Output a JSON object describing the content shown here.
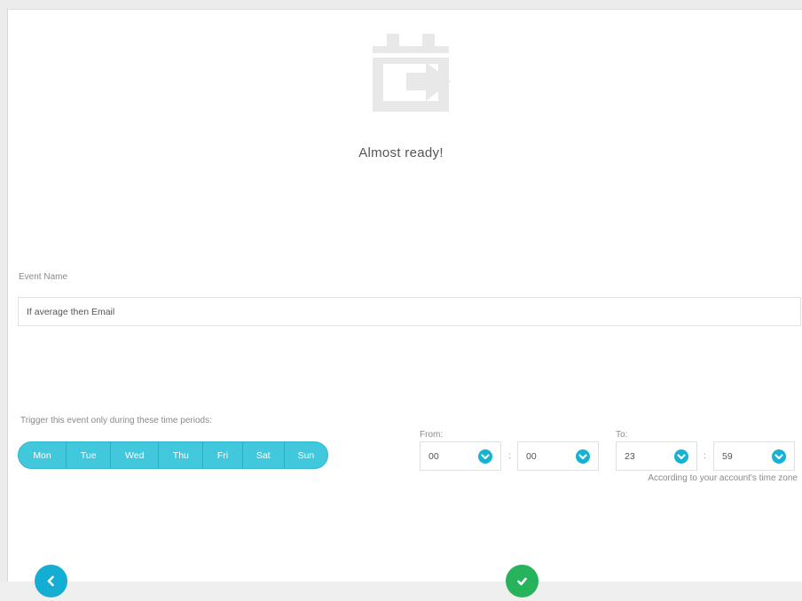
{
  "header": {
    "title": "Almost ready!",
    "icon": "calendar-arrow-icon"
  },
  "event_name": {
    "label": "Event Name",
    "value": "If average then Email"
  },
  "schedule": {
    "label": "Trigger this event only during these time periods:",
    "days": [
      {
        "label": "Mon",
        "selected": true
      },
      {
        "label": "Tue",
        "selected": true
      },
      {
        "label": "Wed",
        "selected": true
      },
      {
        "label": "Thu",
        "selected": true
      },
      {
        "label": "Fri",
        "selected": true
      },
      {
        "label": "Sat",
        "selected": true
      },
      {
        "label": "Sun",
        "selected": true
      }
    ],
    "from": {
      "label": "From:",
      "hour": "00",
      "minute": "00"
    },
    "to": {
      "label": "To:",
      "hour": "23",
      "minute": "59"
    },
    "separator": ":",
    "timezone_note": "According to your account's time zone"
  },
  "footer": {
    "back_icon": "chevron-left-icon",
    "confirm_icon": "checkmark-icon"
  },
  "colors": {
    "accent": "#41c8dc",
    "chevron": "#16b2d4",
    "back_button": "#14aed2",
    "confirm_button": "#27b35b",
    "icon_gray": "#e8e8e8"
  }
}
